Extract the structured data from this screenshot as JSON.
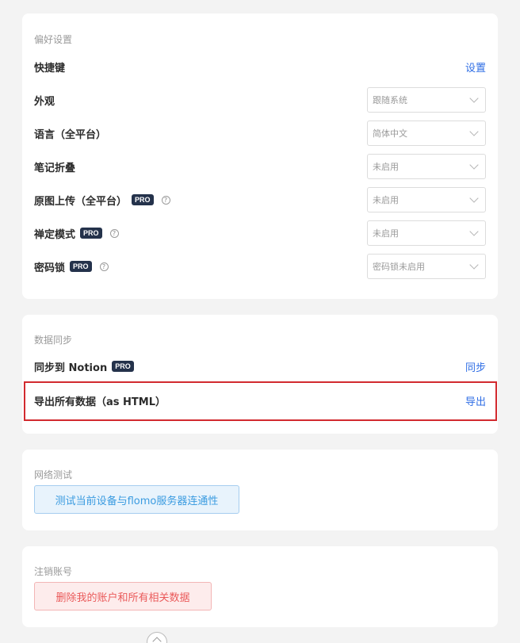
{
  "preferences": {
    "section_title": "偏好设置",
    "shortcut": {
      "label": "快捷键",
      "action": "设置"
    },
    "appearance": {
      "label": "外观",
      "value": "跟随系统"
    },
    "language": {
      "label": "语言（全平台）",
      "value": "简体中文"
    },
    "note_fold": {
      "label": "笔记折叠",
      "value": "未启用"
    },
    "original_upload": {
      "label": "原图上传（全平台）",
      "badge": "PRO",
      "value": "未启用"
    },
    "zen_mode": {
      "label": "禅定模式",
      "badge": "PRO",
      "value": "未启用"
    },
    "password_lock": {
      "label": "密码锁",
      "badge": "PRO",
      "value": "密码锁未启用"
    }
  },
  "data_sync": {
    "section_title": "数据同步",
    "notion": {
      "label": "同步到 Notion",
      "badge": "PRO",
      "action": "同步"
    },
    "export": {
      "label": "导出所有数据（as HTML）",
      "action": "导出"
    }
  },
  "network": {
    "section_title": "网络测试",
    "button": "测试当前设备与flomo服务器连通性"
  },
  "account": {
    "section_title": "注销账号",
    "button": "删除我的账户和所有相关数据"
  },
  "help_glyph": "?",
  "colors": {
    "accent_link": "#2f6ee5",
    "pro_badge": "#24324b",
    "highlight_border": "#d22a2f",
    "danger": "#ea5a5a",
    "info": "#3a9be0"
  }
}
